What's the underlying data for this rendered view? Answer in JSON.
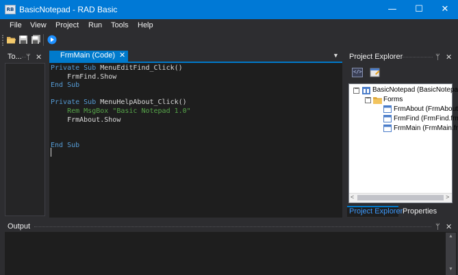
{
  "window": {
    "title": "BasicNotepad - RAD Basic",
    "app_icon_text": "RB",
    "minimize_glyph": "—",
    "maximize_glyph": "☐",
    "close_glyph": "✕"
  },
  "menu": [
    "File",
    "View",
    "Project",
    "Run",
    "Tools",
    "Help"
  ],
  "toolbox": {
    "title": "To...",
    "pin_glyph": "ᛘ",
    "close_glyph": "✕"
  },
  "editor": {
    "tab_label": "FrmMain (Code)",
    "tab_close": "✕",
    "dropdown_glyph": "▼",
    "code": [
      [
        {
          "c": "kw",
          "t": "Private Sub "
        },
        {
          "c": "id",
          "t": "MenuEditFind_Click()"
        }
      ],
      [
        {
          "c": "id",
          "t": "    FrmFind.Show"
        }
      ],
      [
        {
          "c": "kw",
          "t": "End Sub"
        }
      ],
      [],
      [
        {
          "c": "kw",
          "t": "Private Sub "
        },
        {
          "c": "id",
          "t": "MenuHelpAbout_Click()"
        }
      ],
      [
        {
          "c": "cm",
          "t": "    Rem MsgBox \"Basic Notepad 1.0\""
        }
      ],
      [
        {
          "c": "id",
          "t": "    FrmAbout.Show"
        }
      ],
      [],
      [],
      [
        {
          "c": "kw",
          "t": "End Sub"
        }
      ]
    ]
  },
  "project_explorer": {
    "title": "Project Explorer",
    "pin_glyph": "ᛘ",
    "close_glyph": "✕",
    "view_code_icon": "</>",
    "tree": {
      "expand_glyph": "−",
      "root": "BasicNotepad (BasicNotepad",
      "forms": "Forms",
      "items": [
        "FrmAbout (FrmAbout.f",
        "FrmFind (FrmFind.frm)",
        "FrmMain (FrmMain.frm"
      ]
    },
    "scroll_left": "<",
    "scroll_right": ">",
    "tabs": [
      "Project Explorer",
      "Properties"
    ]
  },
  "output": {
    "title": "Output",
    "pin_glyph": "ᛘ",
    "close_glyph": "✕",
    "scroll_up": "▲",
    "scroll_down": "▼"
  },
  "colors": {
    "accent": "#007acc",
    "titlebar": "#0079d6",
    "keyword": "#569cd6",
    "comment": "#57a64a"
  }
}
